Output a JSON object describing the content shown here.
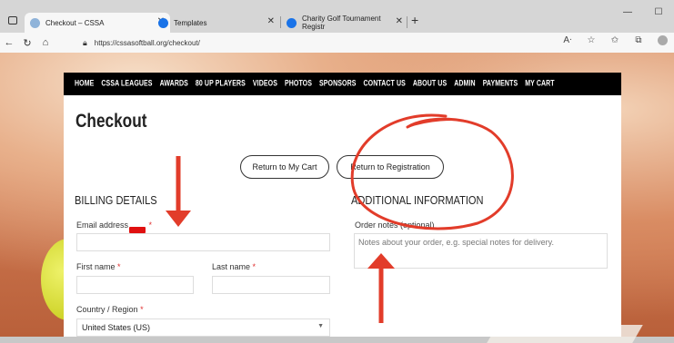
{
  "browser": {
    "tabs": [
      {
        "title": "Checkout – CSSA"
      },
      {
        "title": "Templates"
      },
      {
        "title": "Charity Golf Tournament Registr"
      }
    ],
    "url": "https://cssasoftball.org/checkout/"
  },
  "site": {
    "menu": [
      "HOME",
      "CSSA LEAGUES",
      "AWARDS",
      "80 UP PLAYERS",
      "VIDEOS",
      "PHOTOS",
      "SPONSORS",
      "CONTACT US",
      "ABOUT US",
      "ADMIN",
      "PAYMENTS",
      "MY CART"
    ],
    "page_title": "Checkout",
    "return_cart": "Return to My Cart",
    "return_registration": "Return to Registration",
    "billing_heading": "BILLING DETAILS",
    "additional_heading": "ADDITIONAL INFORMATION",
    "email_label": "Email address",
    "first_name_label": "First name",
    "last_name_label": "Last name",
    "country_label": "Country / Region",
    "country_value": "United States (US)",
    "order_notes_label": "Order notes (optional)",
    "order_notes_placeholder": "Notes about your order, e.g. special notes for delivery.",
    "required_mark": "*"
  },
  "colors": {
    "annotation_red": "#e23c2a",
    "menu_bg": "#000000",
    "required": "#e03030"
  },
  "icons": [
    "sidebar-icon",
    "tab-icon",
    "reload-icon",
    "home-icon",
    "lock-icon",
    "read-aloud-icon",
    "favorites-icon",
    "collections-icon",
    "profile-icon"
  ]
}
